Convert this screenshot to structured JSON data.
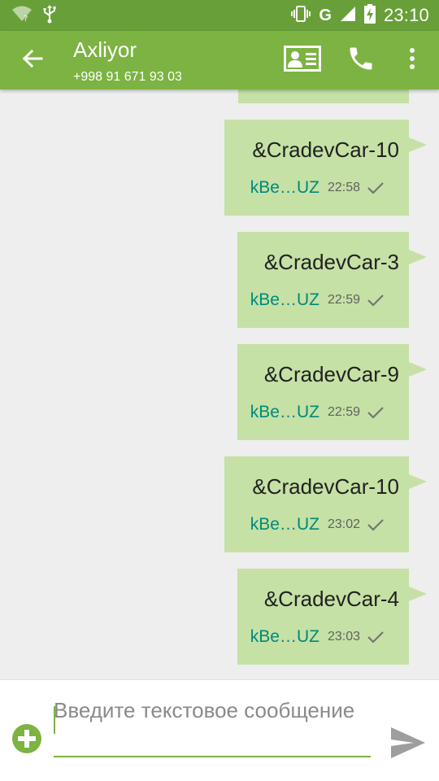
{
  "status_bar": {
    "time": "23:10",
    "network": "G",
    "icons": [
      "wifi-unknown-icon",
      "usb-icon",
      "vibrate-icon",
      "signal-icon",
      "battery-charging-icon"
    ]
  },
  "header": {
    "contact_name": "Axliyor",
    "phone": "+998 91 671 93 03",
    "icons": [
      "back-arrow-icon",
      "contact-card-icon",
      "phone-icon",
      "more-vertical-icon"
    ]
  },
  "messages": [
    {
      "text": "&CradevCar-10",
      "sender": "kBe…UZ",
      "time": "22:58",
      "status": "delivered-check-icon"
    },
    {
      "text": "&CradevCar-3",
      "sender": "kBe…UZ",
      "time": "22:59",
      "status": "delivered-check-icon"
    },
    {
      "text": "&CradevCar-9",
      "sender": "kBe…UZ",
      "time": "22:59",
      "status": "delivered-check-icon"
    },
    {
      "text": "&CradevCar-10",
      "sender": "kBe…UZ",
      "time": "23:02",
      "status": "delivered-check-icon"
    },
    {
      "text": "&CradevCar-4",
      "sender": "kBe…UZ",
      "time": "23:03",
      "status": "delivered-check-icon"
    }
  ],
  "compose": {
    "placeholder": "Введите текстовое сообщение",
    "value": ""
  },
  "colors": {
    "status_bar": "#689f38",
    "app_bar": "#7cb342",
    "bubble": "#c5e1a5",
    "sender": "#00897b",
    "background": "#eeeeee",
    "accent": "#7cb342"
  }
}
